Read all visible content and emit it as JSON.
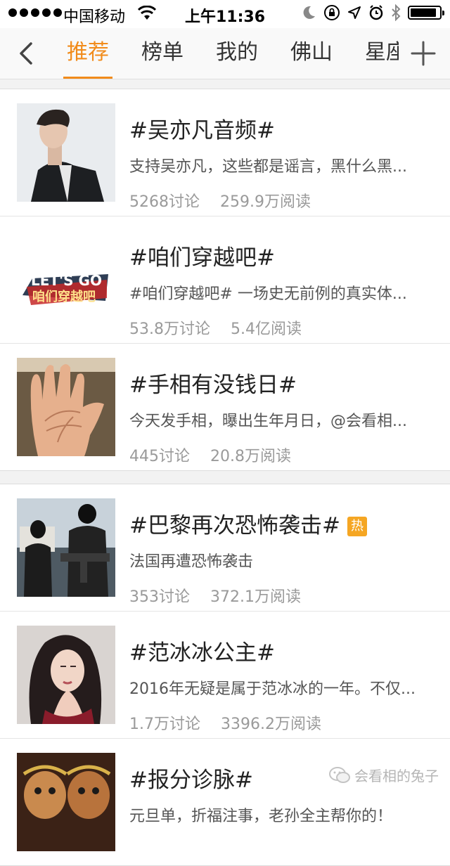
{
  "status_bar": {
    "carrier": "中国移动",
    "time": "上午11:36",
    "signal_bars": 5,
    "battery_level": 0.9
  },
  "nav": {
    "tabs": [
      {
        "label": "推荐"
      },
      {
        "label": "榜单"
      },
      {
        "label": "我的"
      },
      {
        "label": "佛山"
      },
      {
        "label": "星座"
      }
    ],
    "active_tab": "推荐",
    "accent_color": "#f18b1a"
  },
  "topics": [
    {
      "title": "#吴亦凡音频#",
      "desc": "支持吴亦凡，这些都是谣言，黑什么黑...",
      "discussions": "5268讨论",
      "reads": "259.9万阅读"
    },
    {
      "title": "#咱们穿越吧#",
      "desc": "#咱们穿越吧# 一场史无前例的真实体...",
      "discussions": "53.8万讨论",
      "reads": "5.4亿阅读",
      "logo_text": "LET'S GO",
      "logo_text2": "咱们穿越吧"
    },
    {
      "title": "#手相有没钱日#",
      "desc": "今天发手相，曝出生年月日，@会看相...",
      "discussions": "445讨论",
      "reads": "20.8万阅读"
    },
    {
      "title": "#巴黎再次恐怖袭击#",
      "badge": "热",
      "desc": "法国再遭恐怖袭击",
      "discussions": "353讨论",
      "reads": "372.1万阅读"
    },
    {
      "title": "#范冰冰公主#",
      "desc": "2016年无疑是属于范冰冰的一年。不仅...",
      "discussions": "1.7万讨论",
      "reads": "3396.2万阅读"
    },
    {
      "title": "#报分诊脉#",
      "desc": "元旦单，折福注事，老孙全主帮你的！",
      "discussions": "",
      "reads": ""
    }
  ],
  "watermark": {
    "text": "会看相的兔子"
  }
}
